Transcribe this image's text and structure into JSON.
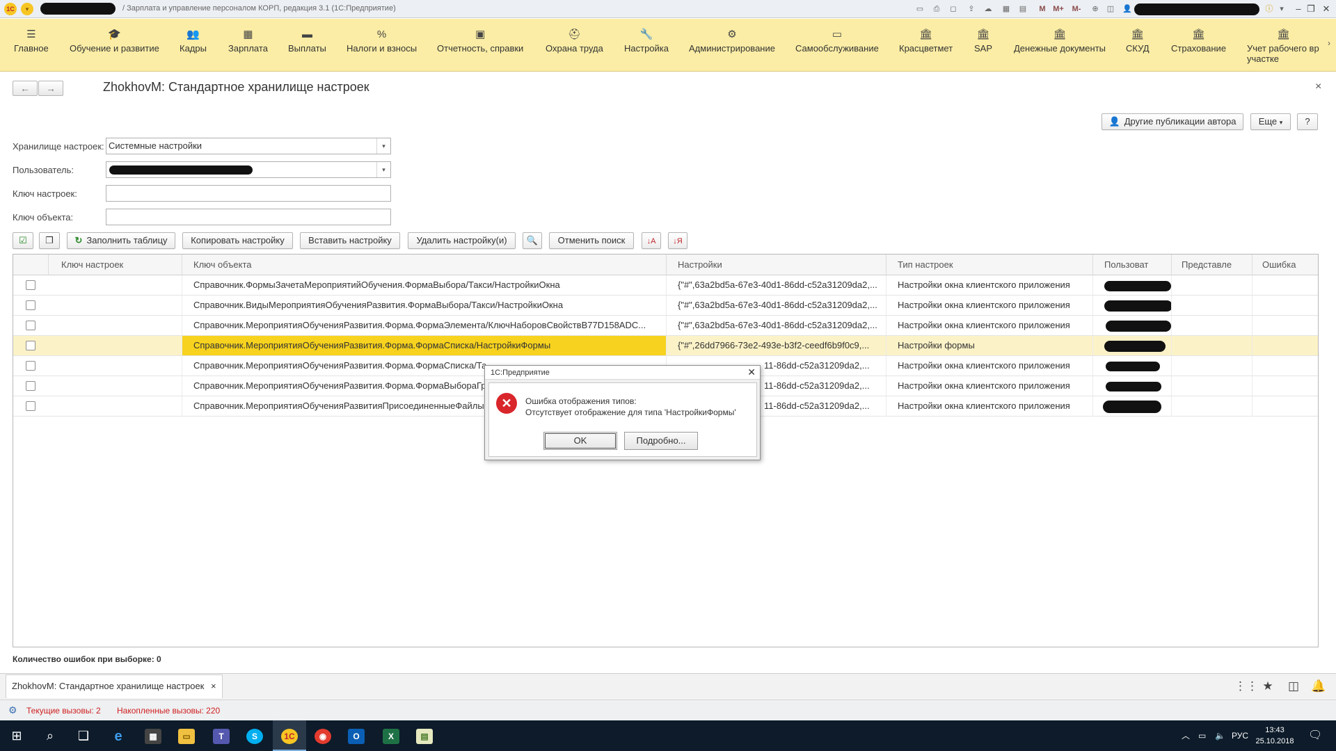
{
  "window": {
    "title": "/ Зарплата и управление персоналом КОРП, редакция 3.1  (1С:Предприятие)",
    "title_icons": [
      "save-icon",
      "print-icon",
      "back-icon",
      "forward-icon",
      "history-icon",
      "calc-icon",
      "calendar-icon"
    ],
    "m_labels": [
      "M",
      "M+",
      "M-"
    ]
  },
  "sections": [
    {
      "label": "Главное",
      "icon": "menu-icon"
    },
    {
      "label": "Обучение и развитие",
      "icon": "graduation-cap-icon"
    },
    {
      "label": "Кадры",
      "icon": "people-icon"
    },
    {
      "label": "Зарплата",
      "icon": "calculator-icon"
    },
    {
      "label": "Выплаты",
      "icon": "wallet-icon"
    },
    {
      "label": "Налоги и взносы",
      "icon": "percent-icon"
    },
    {
      "label": "Отчетность, справки",
      "icon": "report-icon"
    },
    {
      "label": "Охрана труда",
      "icon": "helmet-icon"
    },
    {
      "label": "Настройка",
      "icon": "wrench-icon"
    },
    {
      "label": "Администрирование",
      "icon": "gear-icon"
    },
    {
      "label": "Самообслуживание",
      "icon": "monitor-icon"
    },
    {
      "label": "Красцветмет",
      "icon": "building-icon"
    },
    {
      "label": "SAP",
      "icon": "building-icon"
    },
    {
      "label": "Денежные документы",
      "icon": "building-icon"
    },
    {
      "label": "СКУД",
      "icon": "building-icon"
    },
    {
      "label": "Страхование",
      "icon": "building-icon"
    },
    {
      "label": "Учет рабочего вр участке",
      "icon": "building-icon"
    }
  ],
  "form": {
    "title": "ZhokhovM: Стандартное хранилище настроек",
    "other_publications": "Другие публикации автора",
    "more": "Еще",
    "help": "?",
    "fields": {
      "storage_label": "Хранилище настроек:",
      "storage_value": "Системные настройки",
      "user_label": "Пользователь:",
      "settings_key_label": "Ключ настроек:",
      "object_key_label": "Ключ объекта:"
    },
    "toolbar": {
      "fill": "Заполнить таблицу",
      "copy": "Копировать настройку",
      "paste": "Вставить настройку",
      "delete": "Удалить настройку(и)",
      "cancel_search": "Отменить поиск"
    }
  },
  "table": {
    "columns": [
      "Ключ настроек",
      "Ключ объекта",
      "Настройки",
      "Тип настроек",
      "Пользоват",
      "Представле",
      "Ошибка"
    ],
    "rows": [
      {
        "object_key": "Справочник.ФормыЗачетаМероприятийОбучения.ФормаВыбора/Такси/НастройкиОкна",
        "settings": "{\"#\",63a2bd5a-67e3-40d1-86dd-c52a31209da2,...",
        "type": "Настройки окна клиентского приложения"
      },
      {
        "object_key": "Справочник.ВидыМероприятияОбученияРазвития.ФормаВыбора/Такси/НастройкиОкна",
        "settings": "{\"#\",63a2bd5a-67e3-40d1-86dd-c52a31209da2,...",
        "type": "Настройки окна клиентского приложения"
      },
      {
        "object_key": "Справочник.МероприятияОбученияРазвития.Форма.ФормаЭлемента/КлючНаборовСвойствB77D158ADC...",
        "settings": "{\"#\",63a2bd5a-67e3-40d1-86dd-c52a31209da2,...",
        "type": "Настройки окна клиентского приложения"
      },
      {
        "object_key": "Справочник.МероприятияОбученияРазвития.Форма.ФормаСписка/НастройкиФормы",
        "settings": "{\"#\",26dd7966-73e2-493e-b3f2-ceedf6b9f0c9,...",
        "type": "Настройки формы"
      },
      {
        "object_key": "Справочник.МероприятияОбученияРазвития.Форма.ФормаСписка/Та",
        "settings": "11-86dd-c52a31209da2,...",
        "type": "Настройки окна клиентского приложения"
      },
      {
        "object_key": "Справочник.МероприятияОбученияРазвития.Форма.ФормаВыбораГруппы/Та",
        "settings": "11-86dd-c52a31209da2,...",
        "type": "Настройки окна клиентского приложения"
      },
      {
        "object_key": "Справочник.МероприятияОбученияРазвитияПрисоединенныеФайлы.(",
        "settings": "11-86dd-c52a31209da2,...",
        "type": "Настройки окна клиентского приложения"
      }
    ],
    "selected_row": 3
  },
  "footer": {
    "error_count": "Количество ошибок при выборке: 0",
    "open_tab": "ZhokhovM: Стандартное хранилище настроек",
    "tab_close": "×",
    "status_current": "Текущие вызовы: 2",
    "status_accumulated": "Накопленные вызовы: 220"
  },
  "taskbar": {
    "lang": "РУС",
    "time": "13:43",
    "date": "25.10.2018"
  },
  "dialog": {
    "title": "1С:Предприятие",
    "line1": "Ошибка отображения типов:",
    "line2": "Отсутствует отображение для типа 'НастройкиФормы'",
    "ok": "OK",
    "details": "Подробно..."
  },
  "colors": {
    "sections_bg": "#fbeda5",
    "selected_cell": "#f7d21e",
    "status_red": "#d01e1e",
    "error_icon": "#d9262b"
  }
}
